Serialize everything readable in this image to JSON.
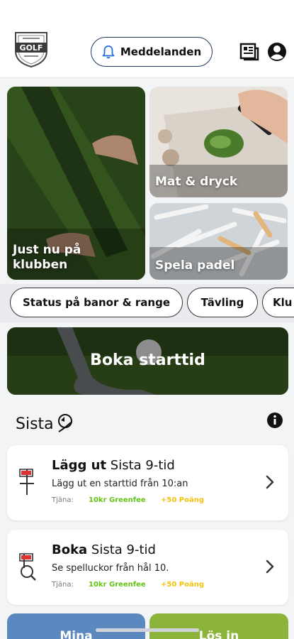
{
  "header": {
    "logo_text": "GOLF",
    "notifications_label": "Meddelanden"
  },
  "tiles": {
    "club_now": "Just nu på klubben",
    "food_drink": "Mat & dryck",
    "padel": "Spela padel"
  },
  "chips": [
    "Status på banor & range",
    "Tävling",
    "Klu"
  ],
  "book_tee": "Boka starttid",
  "section": {
    "title": "Sista"
  },
  "cards": [
    {
      "title_bold": "Lägg ut",
      "title_rest": " Sista 9-tid",
      "subtitle": "Lägg ut en starttid från 10:an",
      "earn_label": "Tjäna:",
      "greenfee": "10kr Greenfee",
      "points": "+50 Poäng"
    },
    {
      "title_bold": "Boka",
      "title_rest": " Sista 9-tid",
      "subtitle": "Se spelluckor från hål 10.",
      "earn_label": "Tjäna:",
      "greenfee": "10kr Greenfee",
      "points": "+50 Poäng"
    }
  ],
  "bottom": {
    "left": "Mina",
    "right": "Lös in"
  },
  "colors": {
    "greenfee": "#63c316",
    "points": "#f4c20d",
    "bottom_left": "#5b89bf",
    "bottom_right": "#8cb43a"
  },
  "icons": [
    "bell-icon",
    "news-icon",
    "profile-icon",
    "info-icon",
    "flag-icon",
    "flag-search-icon",
    "chevron-right-icon"
  ]
}
